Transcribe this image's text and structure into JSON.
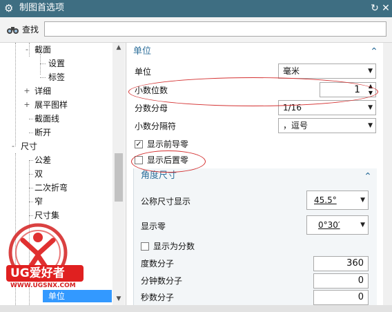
{
  "window": {
    "title": "制图首选项"
  },
  "find": {
    "label": "查找",
    "value": ""
  },
  "tree": {
    "items": [
      {
        "label": "截面",
        "toggle": "-"
      },
      {
        "label": "设置",
        "toggle": ""
      },
      {
        "label": "标签",
        "toggle": ""
      },
      {
        "label": "详细",
        "toggle": "+"
      },
      {
        "label": "展平图样",
        "toggle": "+"
      },
      {
        "label": "截面线",
        "toggle": ""
      },
      {
        "label": "断开",
        "toggle": ""
      },
      {
        "label": "尺寸",
        "toggle": "-"
      },
      {
        "label": "公差",
        "toggle": ""
      },
      {
        "label": "双",
        "toggle": ""
      },
      {
        "label": "二次折弯",
        "toggle": ""
      },
      {
        "label": "窄",
        "toggle": ""
      },
      {
        "label": "尺寸集",
        "toggle": ""
      },
      {
        "label": "单位",
        "toggle": ""
      }
    ],
    "selected_label": "单位"
  },
  "units_section": {
    "header": "单位",
    "unit_label": "单位",
    "unit_value": "毫米",
    "decimal_places_label": "小数位数",
    "decimal_places_value": "1",
    "fraction_label": "分数分母",
    "fraction_value": "1/16",
    "separator_label": "小数分隔符",
    "separator_value": "，逗号",
    "leading_zero_label": "显示前导零",
    "leading_zero_checked": true,
    "trailing_zero_label": "显示后置零",
    "trailing_zero_checked": false
  },
  "angle_section": {
    "header": "角度尺寸",
    "nominal_label": "公称尺寸显示",
    "nominal_value": "45.5°",
    "zero_label": "显示零",
    "zero_value": "0°30′",
    "fraction_label": "显示为分数",
    "fraction_checked": false,
    "degree_denominator_label": "度数分子",
    "degree_denominator_value": "360",
    "minute_denominator_label": "分钟数分子",
    "minute_denominator_value": "0",
    "second_denominator_label": "秒数分子",
    "second_denominator_value": "0"
  },
  "watermark": {
    "brand": "UG爱好者",
    "url": "WWW.UGSNX.COM"
  },
  "colors": {
    "title_bar": "#3e6e82",
    "selection": "#3399ff",
    "section_header": "#2e6f9b",
    "annotation": "#d43030"
  }
}
